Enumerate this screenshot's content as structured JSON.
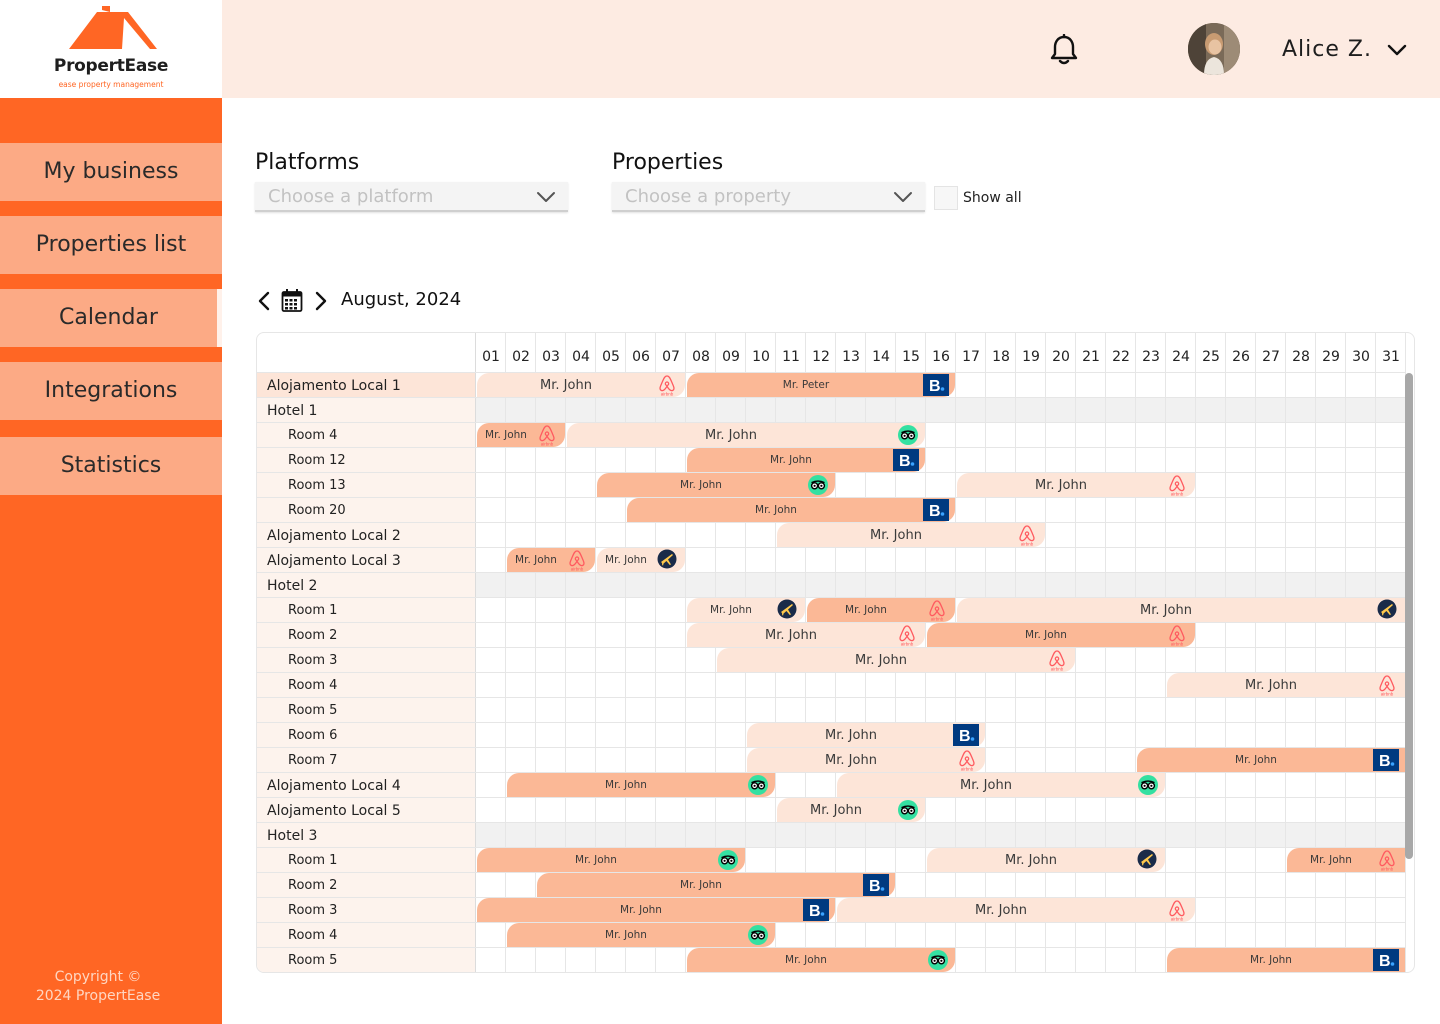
{
  "brand": {
    "name": "PropertEase",
    "tagline": "ease property management",
    "color": "#ff6624"
  },
  "sidebar": {
    "items": [
      {
        "label": "My business",
        "id": "my-business"
      },
      {
        "label": "Properties list",
        "id": "properties-list"
      },
      {
        "label": "Calendar",
        "id": "calendar",
        "active": true
      },
      {
        "label": "Integrations",
        "id": "integrations"
      },
      {
        "label": "Statistics",
        "id": "statistics"
      }
    ],
    "copyright_line1": "Copyright ©",
    "copyright_line2": "2024 PropertEase"
  },
  "header": {
    "user_name": "Alice Z.",
    "bell_icon": "bell-icon",
    "avatar_icon": "user-avatar"
  },
  "filters": {
    "platforms_label": "Platforms",
    "platforms_placeholder": "Choose a platform",
    "properties_label": "Properties",
    "properties_placeholder": "Choose a property",
    "show_all_label": "Show all",
    "show_all_checked": false
  },
  "calendar": {
    "month_label": "August, 2024",
    "days": [
      "01",
      "02",
      "03",
      "04",
      "05",
      "06",
      "07",
      "08",
      "09",
      "10",
      "11",
      "12",
      "13",
      "14",
      "15",
      "16",
      "17",
      "18",
      "19",
      "20",
      "21",
      "22",
      "23",
      "24",
      "25",
      "26",
      "27",
      "28",
      "29",
      "30",
      "31"
    ],
    "colors": {
      "confirmed": "#fbb896",
      "pending": "#fde5d8",
      "group": "#f1f1f1",
      "label_bg": "#fdf3ed",
      "label_bg_top": "#fde5d8"
    },
    "platform_icons": {
      "airbnb": "airbnb-icon",
      "booking": "booking-icon",
      "tripadvisor": "tripadvisor-icon",
      "expedia": "expedia-icon"
    },
    "rows": [
      {
        "label": "Alojamento Local 1",
        "kind": "property"
      },
      {
        "label": "Hotel 1",
        "kind": "group"
      },
      {
        "label": "Room 4",
        "kind": "room"
      },
      {
        "label": "Room 12",
        "kind": "room"
      },
      {
        "label": "Room 13",
        "kind": "room"
      },
      {
        "label": "Room 20",
        "kind": "room"
      },
      {
        "label": "Alojamento Local 2",
        "kind": "property"
      },
      {
        "label": "Alojamento Local 3",
        "kind": "property"
      },
      {
        "label": "Hotel 2",
        "kind": "group"
      },
      {
        "label": "Room 1",
        "kind": "room"
      },
      {
        "label": "Room 2",
        "kind": "room"
      },
      {
        "label": "Room 3",
        "kind": "room"
      },
      {
        "label": "Room 4",
        "kind": "room"
      },
      {
        "label": "Room 5",
        "kind": "room"
      },
      {
        "label": "Room 6",
        "kind": "room"
      },
      {
        "label": "Room 7",
        "kind": "room"
      },
      {
        "label": "Alojamento Local 4",
        "kind": "property"
      },
      {
        "label": "Alojamento Local 5",
        "kind": "property"
      },
      {
        "label": "Hotel 3",
        "kind": "group"
      },
      {
        "label": "Room 1",
        "kind": "room"
      },
      {
        "label": "Room 2",
        "kind": "room"
      },
      {
        "label": "Room 3",
        "kind": "room"
      },
      {
        "label": "Room 4",
        "kind": "room"
      },
      {
        "label": "Room 5",
        "kind": "room"
      }
    ],
    "bookings": [
      {
        "row": 0,
        "start": 1,
        "end": 7,
        "guest": "Mr. John",
        "platform": "airbnb",
        "status": "pending"
      },
      {
        "row": 0,
        "start": 8,
        "end": 16,
        "guest": "Mr. Peter",
        "platform": "booking",
        "status": "confirmed"
      },
      {
        "row": 2,
        "start": 1,
        "end": 3,
        "guest": "Mr. John",
        "platform": "airbnb",
        "status": "confirmed"
      },
      {
        "row": 2,
        "start": 4,
        "end": 15,
        "guest": "Mr. John",
        "platform": "tripadvisor",
        "status": "pending"
      },
      {
        "row": 3,
        "start": 8,
        "end": 15,
        "guest": "Mr. John",
        "platform": "booking",
        "status": "confirmed"
      },
      {
        "row": 4,
        "start": 5,
        "end": 12,
        "guest": "Mr. John",
        "platform": "tripadvisor",
        "status": "confirmed"
      },
      {
        "row": 4,
        "start": 17,
        "end": 24,
        "guest": "Mr. John",
        "platform": "airbnb",
        "status": "pending"
      },
      {
        "row": 5,
        "start": 6,
        "end": 16,
        "guest": "Mr. John",
        "platform": "booking",
        "status": "confirmed"
      },
      {
        "row": 6,
        "start": 11,
        "end": 19,
        "guest": "Mr. John",
        "platform": "airbnb",
        "status": "pending"
      },
      {
        "row": 7,
        "start": 2,
        "end": 4,
        "guest": "Mr. John",
        "platform": "airbnb",
        "status": "confirmed"
      },
      {
        "row": 7,
        "start": 5,
        "end": 7,
        "guest": "Mr. John",
        "platform": "expedia",
        "status": "pending"
      },
      {
        "row": 9,
        "start": 8,
        "end": 11,
        "guest": "Mr. John",
        "platform": "expedia",
        "status": "pending"
      },
      {
        "row": 9,
        "start": 12,
        "end": 16,
        "guest": "Mr. John",
        "platform": "airbnb",
        "status": "confirmed"
      },
      {
        "row": 9,
        "start": 17,
        "end": 31,
        "guest": "Mr. John",
        "platform": "expedia",
        "status": "pending"
      },
      {
        "row": 10,
        "start": 8,
        "end": 15,
        "guest": "Mr. John",
        "platform": "airbnb",
        "status": "pending"
      },
      {
        "row": 10,
        "start": 16,
        "end": 24,
        "guest": "Mr. John",
        "platform": "airbnb",
        "status": "confirmed"
      },
      {
        "row": 11,
        "start": 9,
        "end": 20,
        "guest": "Mr. John",
        "platform": "airbnb",
        "status": "pending"
      },
      {
        "row": 12,
        "start": 24,
        "end": 31,
        "guest": "Mr. John",
        "platform": "airbnb",
        "status": "pending"
      },
      {
        "row": 14,
        "start": 10,
        "end": 17,
        "guest": "Mr. John",
        "platform": "booking",
        "status": "pending"
      },
      {
        "row": 15,
        "start": 10,
        "end": 17,
        "guest": "Mr. John",
        "platform": "airbnb",
        "status": "pending"
      },
      {
        "row": 15,
        "start": 23,
        "end": 31,
        "guest": "Mr. John",
        "platform": "booking",
        "status": "confirmed"
      },
      {
        "row": 16,
        "start": 2,
        "end": 10,
        "guest": "Mr. John",
        "platform": "tripadvisor",
        "status": "confirmed"
      },
      {
        "row": 16,
        "start": 13,
        "end": 23,
        "guest": "Mr. John",
        "platform": "tripadvisor",
        "status": "pending"
      },
      {
        "row": 17,
        "start": 11,
        "end": 15,
        "guest": "Mr. John",
        "platform": "tripadvisor",
        "status": "pending"
      },
      {
        "row": 19,
        "start": 1,
        "end": 9,
        "guest": "Mr. John",
        "platform": "tripadvisor",
        "status": "confirmed"
      },
      {
        "row": 19,
        "start": 16,
        "end": 23,
        "guest": "Mr. John",
        "platform": "expedia",
        "status": "pending"
      },
      {
        "row": 19,
        "start": 28,
        "end": 31,
        "guest": "Mr. John",
        "platform": "airbnb",
        "status": "confirmed"
      },
      {
        "row": 20,
        "start": 3,
        "end": 14,
        "guest": "Mr. John",
        "platform": "booking",
        "status": "confirmed"
      },
      {
        "row": 21,
        "start": 1,
        "end": 12,
        "guest": "Mr. John",
        "platform": "booking",
        "status": "confirmed"
      },
      {
        "row": 21,
        "start": 13,
        "end": 24,
        "guest": "Mr. John",
        "platform": "airbnb",
        "status": "pending"
      },
      {
        "row": 22,
        "start": 2,
        "end": 10,
        "guest": "Mr. John",
        "platform": "tripadvisor",
        "status": "confirmed"
      },
      {
        "row": 23,
        "start": 8,
        "end": 16,
        "guest": "Mr. John",
        "platform": "tripadvisor",
        "status": "confirmed"
      },
      {
        "row": 23,
        "start": 24,
        "end": 31,
        "guest": "Mr. John",
        "platform": "booking",
        "status": "confirmed"
      }
    ]
  }
}
